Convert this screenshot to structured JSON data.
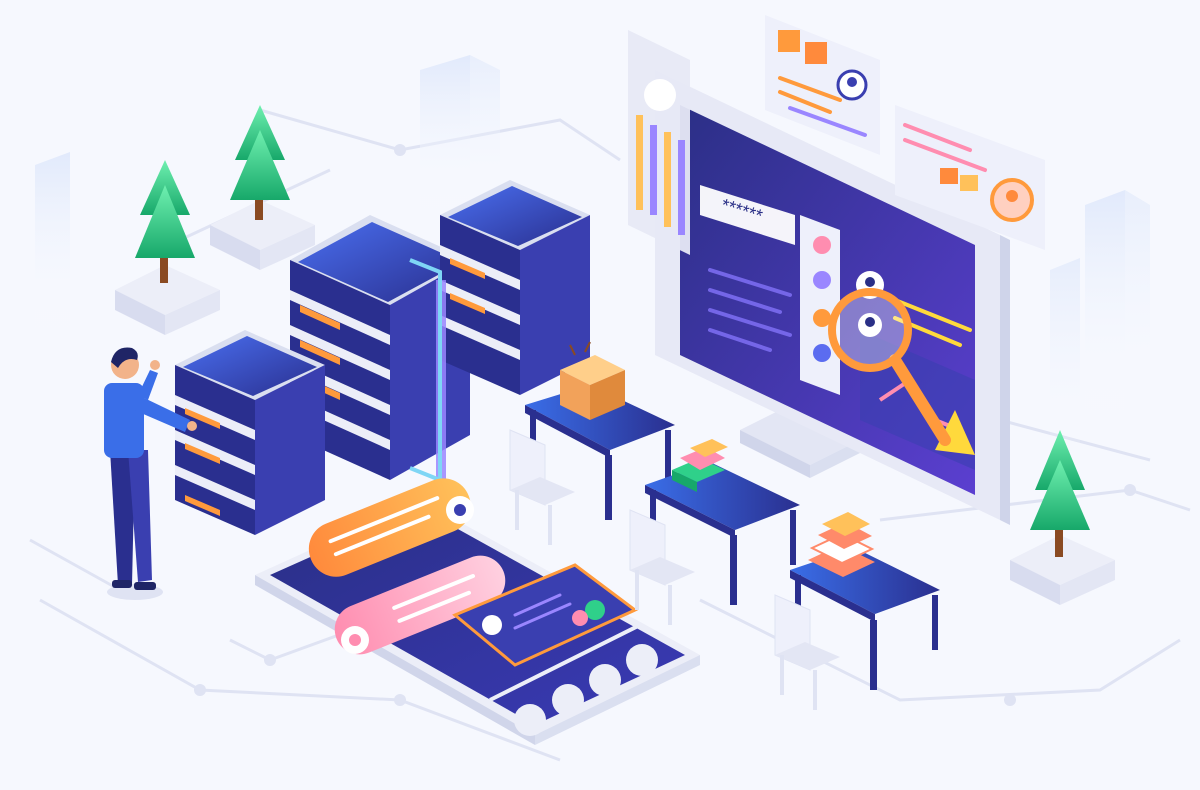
{
  "scene": {
    "description_free": true,
    "palette": {
      "background": "#f4f6fd",
      "navy": "#25307a",
      "indigo": "#3a3fb0",
      "violet": "#6b4bd6",
      "blue": "#3f6fe6",
      "cyan": "#5ad4f0",
      "orange": "#ff9a3c",
      "orange_light": "#ffc15a",
      "pink": "#ff7fa8",
      "green": "#2fd08a",
      "green_dark": "#17a86a",
      "slab": "#eceef8",
      "slab_shadow": "#d8dcef",
      "trunk": "#8a4a22",
      "skin": "#f2b38a"
    },
    "screen": {
      "password_mask": "******"
    },
    "icons": [
      "server-rack-icon",
      "monitor-icon",
      "magnifier-icon",
      "phone-icon",
      "profile-card-icon",
      "tree-icon",
      "desk-icon",
      "chair-icon",
      "boxes-icon",
      "books-icon",
      "person-icon"
    ]
  }
}
